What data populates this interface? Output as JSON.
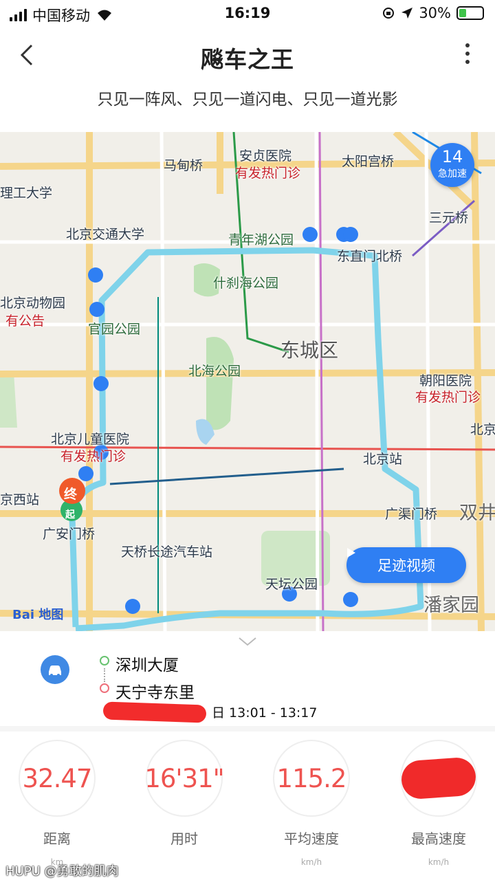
{
  "status_bar": {
    "carrier": "中国移动",
    "time": "16:19",
    "battery": "30%",
    "battery_level": 0.3
  },
  "nav": {
    "title": "飚车之王",
    "subtitle": "只见一阵风、只见一道闪电、只见一道光影"
  },
  "map": {
    "badge": {
      "count": "14",
      "label": "急加速"
    },
    "video_button": "足迹视频",
    "end_marker": "终",
    "start_marker": "起",
    "logo_text": "Bai",
    "logo_suffix": "地图",
    "labels": {
      "majiaqiao": "马甸桥",
      "anzhen": "安贞医院",
      "anzhen_sub": "有发热门诊",
      "taiyang": "太阳宫桥",
      "ligong": "理工大学",
      "jiaoda": "北京交通大学",
      "qingnianhu": "青年湖公园",
      "dongzhimen": "东直门北桥",
      "sanyuan": "三元桥",
      "shichahai": "什刹海公园",
      "dongwuyuan": "北京动物园",
      "notice": "有公告",
      "guanyuan": "官园公园",
      "dongcheng": "东城区",
      "beihai": "北海公园",
      "chaoyang": "朝阳医院",
      "chaoyang_sub": "有发热门诊",
      "ertong": "北京儿童医院",
      "ertong_sub": "有发热门诊",
      "beijingzhan": "北京站",
      "xizhan": "京西站",
      "guangan": "广安门桥",
      "guangqu": "广渠门桥",
      "shuangjing": "双井",
      "tianqiao": "天桥长途汽车站",
      "tiantan": "天坛公园",
      "panjiayuan": "潘家园",
      "bei_right": "北京"
    }
  },
  "trip": {
    "from": "深圳大厦",
    "to": "天宁寺东里",
    "time_range": "日 13:01 - 13:17"
  },
  "stats": [
    {
      "value": "32.47",
      "label": "距离",
      "unit": "km"
    },
    {
      "value": "16'31\"",
      "label": "用时",
      "unit": ""
    },
    {
      "value": "115.2",
      "label": "平均速度",
      "unit": "km/h"
    },
    {
      "value": "",
      "label": "最高速度",
      "unit": "km/h"
    }
  ],
  "watermark": "HUPU @勇敢的肌肉",
  "colors": {
    "accent": "#2f7ff3",
    "route": "#7fd3ea",
    "stat_value": "#ee5350"
  }
}
